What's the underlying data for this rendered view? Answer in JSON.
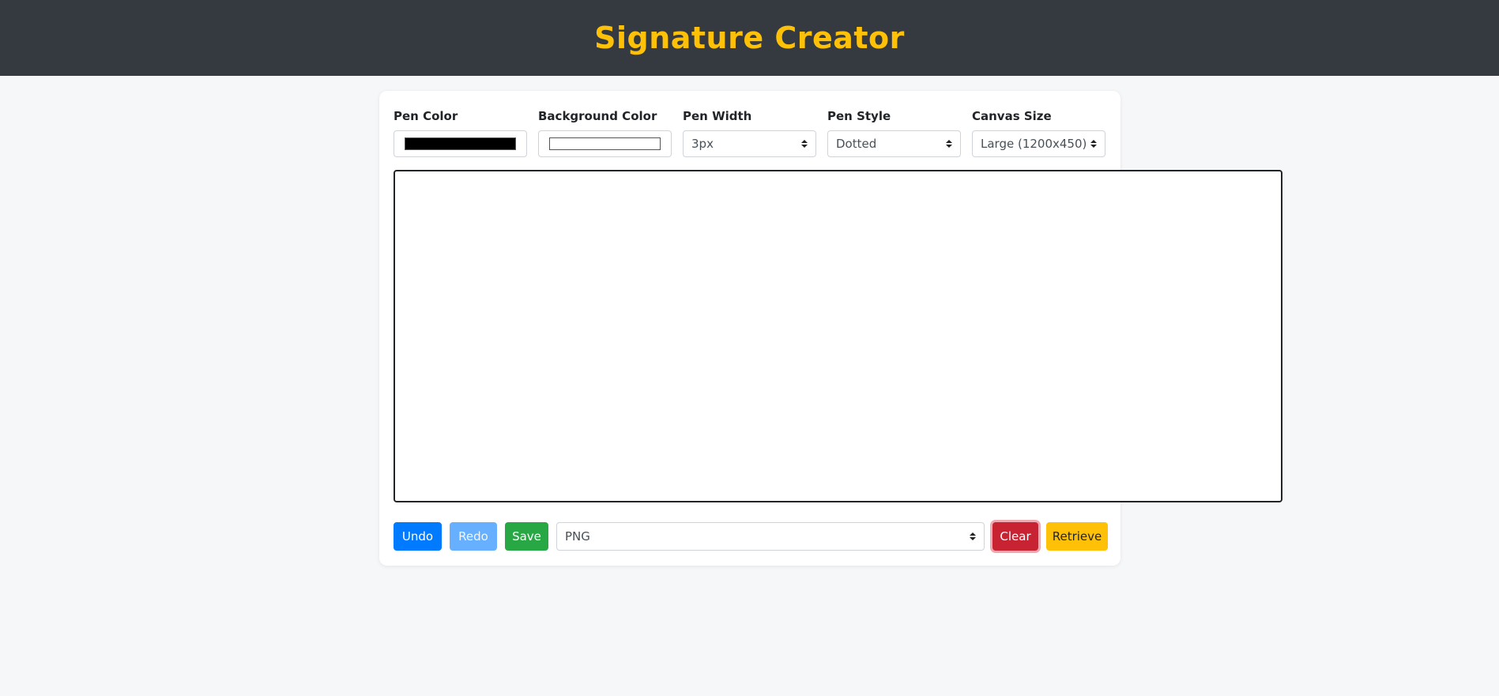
{
  "header": {
    "title": "Signature Creator"
  },
  "colors": {
    "header_bg": "#343a40",
    "title": "#ffc107",
    "pen_color": "#000000",
    "background_color": "#ffffff"
  },
  "controls": {
    "pen_color": {
      "label": "Pen Color",
      "value": "#000000"
    },
    "background_color": {
      "label": "Background Color",
      "value": "#ffffff"
    },
    "pen_width": {
      "label": "Pen Width",
      "value": "3px"
    },
    "pen_style": {
      "label": "Pen Style",
      "value": "Dotted"
    },
    "canvas_size": {
      "label": "Canvas Size",
      "value": "Large (1200x450)"
    }
  },
  "actions": {
    "undo": "Undo",
    "redo": "Redo",
    "save": "Save",
    "format": "PNG",
    "clear": "Clear",
    "retrieve": "Retrieve"
  }
}
